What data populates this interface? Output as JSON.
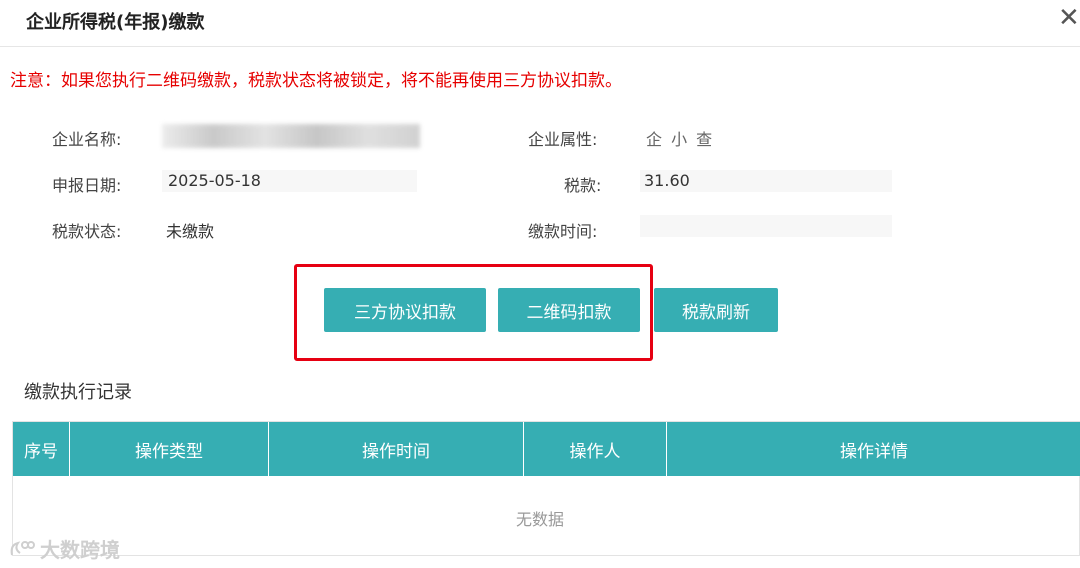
{
  "dialog": {
    "title": "企业所得税(年报)缴款",
    "close_glyph": "✕",
    "warning": "注意：如果您执行二维码缴款，税款状态将被锁定，将不能再使用三方协议扣款。"
  },
  "info": {
    "company_name_label": "企业名称:",
    "company_attr_label": "企业属性:",
    "company_attr_value": "企 小 查",
    "report_date_label": "申报日期:",
    "report_date_value": "2025-05-18",
    "tax_label": "税款:",
    "tax_value": "31.60",
    "tax_status_label": "税款状态:",
    "tax_status_value": "未缴款",
    "pay_time_label": "缴款时间:",
    "pay_time_value": ""
  },
  "buttons": {
    "tripartite": "三方协议扣款",
    "qrcode": "二维码扣款",
    "refresh": "税款刷新"
  },
  "records": {
    "title": "缴款执行记录",
    "columns": [
      "序号",
      "操作类型",
      "操作时间",
      "操作人",
      "操作详情"
    ],
    "empty_text": "无数据"
  },
  "watermark": {
    "text": "大数跨境",
    "icon": "watermark-logo-icon"
  },
  "colors": {
    "accent": "#36aeb3",
    "warning": "#e60000",
    "highlight_border": "#e60012"
  }
}
